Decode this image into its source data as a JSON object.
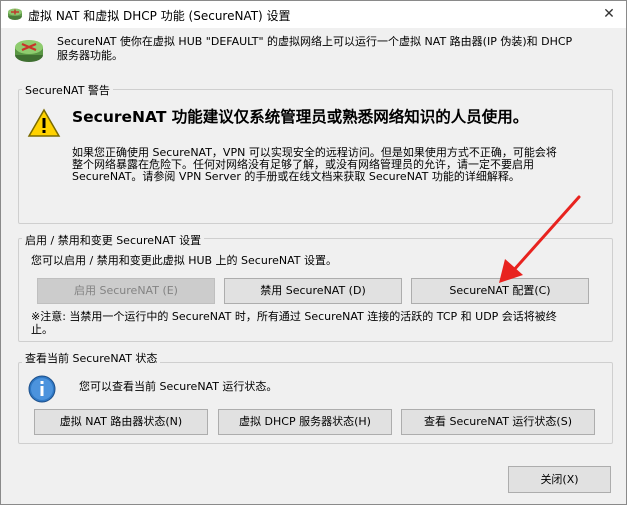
{
  "window": {
    "title": "虚拟 NAT 和虚拟 DHCP 功能 (SecureNAT) 设置",
    "close_glyph": "✕",
    "intro_line1": "SecureNAT 使你在虚拟 HUB \"DEFAULT\" 的虚拟网络上可以运行一个虚拟 NAT 路由器(IP 伪装)和 DHCP",
    "intro_line2": "服务器功能。"
  },
  "warning_group": {
    "title": "SecureNAT 警告",
    "headline": "SecureNAT 功能建议仅系统管理员或熟悉网络知识的人员使用。",
    "body_lines": [
      "如果您正确使用 SecureNAT，VPN 可以实现安全的远程访问。但是如果使用方式不正确，可能会将",
      "整个网络暴露在危险下。任何对网络没有足够了解，或没有网络管理员的允许，请一定不要启用",
      "SecureNAT。请参阅 VPN Server 的手册或在线文档来获取 SecureNAT 功能的详细解释。"
    ]
  },
  "control_group": {
    "title": "启用 / 禁用和变更 SecureNAT 设置",
    "description": "您可以启用 / 禁用和变更此虚拟 HUB 上的 SecureNAT 设置。",
    "enable_label": "启用 SecureNAT (E)",
    "disable_label": "禁用 SecureNAT (D)",
    "config_label": "SecureNAT 配置(C)",
    "note_line1": "※注意: 当禁用一个运行中的 SecureNAT 时，所有通过 SecureNAT 连接的活跃的 TCP 和 UDP 会话将被终",
    "note_line2": "止。"
  },
  "status_group": {
    "title": "查看当前 SecureNAT 状态",
    "description": "您可以查看当前 SecureNAT 运行状态。",
    "nat_status_label": "虚拟 NAT 路由器状态(N)",
    "dhcp_status_label": "虚拟 DHCP 服务器状态(H)",
    "run_status_label": "查看 SecureNAT 运行状态(S)"
  },
  "footer": {
    "close_label": "关闭(X)"
  },
  "colors": {
    "annotation_arrow": "#e8231f",
    "warning_yellow": "#ffd200",
    "info_blue": "#2f78c4"
  }
}
